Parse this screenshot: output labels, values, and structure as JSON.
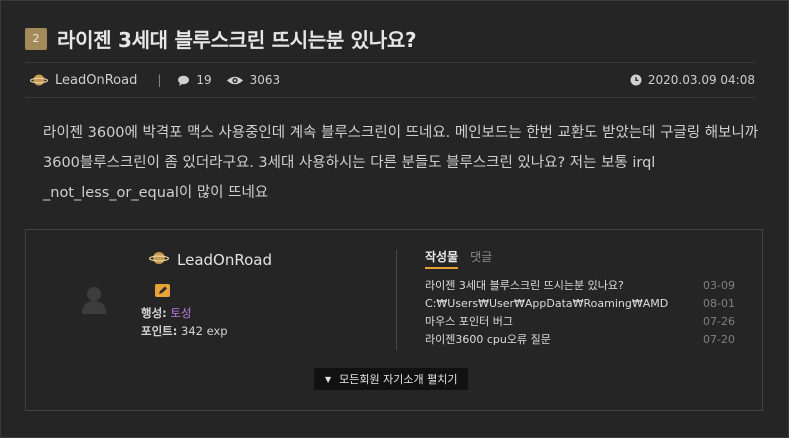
{
  "post": {
    "number": "2",
    "title": "라이젠 3세대 블루스크린 뜨시는분 있나요?",
    "author": "LeadOnRoad",
    "separator": "|",
    "comments": "19",
    "views": "3063",
    "date": "2020.03.09 04:08",
    "body": "라이젠 3600에 박격포 맥스 사용중인데 계속 블루스크린이 뜨네요. 메인보드는 한번 교환도 받았는데 구글링 해보니까 3600블루스크린이 좀 있더라구요. 3세대 사용하시는 다른 분들도 블루스크린 있나요?  저는 보통 irql _not_less_or_equal이 많이 뜨네요"
  },
  "profile": {
    "name": "LeadOnRoad",
    "behavior_label": "행성:",
    "behavior_value": "토성",
    "points_label": "포인트:",
    "points_value": "342 exp",
    "tabs": [
      "작성물",
      "댓글"
    ],
    "posts": [
      {
        "title": "라이젠 3세대 블루스크린 뜨시는분 있나요?",
        "date": "03-09"
      },
      {
        "title": "C:₩Users₩User₩AppData₩Roaming₩AMD",
        "date": "08-01"
      },
      {
        "title": "마우스 포인터 버그",
        "date": "07-26"
      },
      {
        "title": "라이젠3600 cpu오류 질문",
        "date": "07-20"
      }
    ],
    "expand_label": "모든회원 자기소개 펼치기"
  },
  "colors": {
    "background": "#252525",
    "badge": "#a28a5b",
    "accent_orange": "#e9a23a",
    "accent_purple": "#b77be0"
  }
}
